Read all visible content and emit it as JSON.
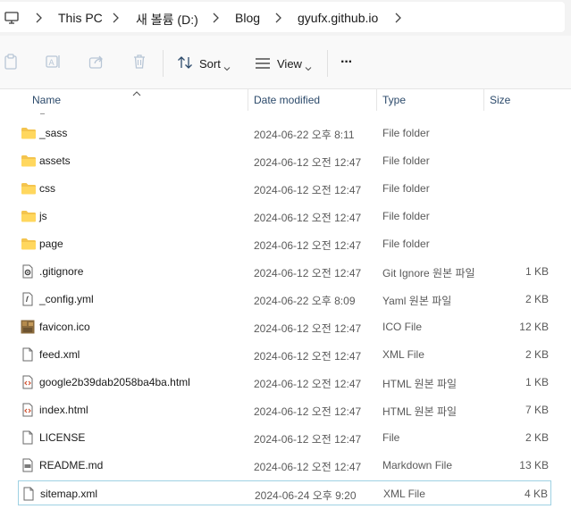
{
  "breadcrumb": [
    "This PC",
    "새 볼륨 (D:)",
    "Blog",
    "gyufx.github.io"
  ],
  "toolbar": {
    "sort_label": "Sort",
    "view_label": "View",
    "more_label": "···"
  },
  "columns": {
    "name": "Name",
    "date": "Date modified",
    "type": "Type",
    "size": "Size"
  },
  "files": [
    {
      "name": "_sass",
      "date": "2024-06-22 오후 8:11",
      "type": "File folder",
      "size": "",
      "icon": "folder-icon"
    },
    {
      "name": "assets",
      "date": "2024-06-12 오전 12:47",
      "type": "File folder",
      "size": "",
      "icon": "folder-icon"
    },
    {
      "name": "css",
      "date": "2024-06-12 오전 12:47",
      "type": "File folder",
      "size": "",
      "icon": "folder-icon"
    },
    {
      "name": "js",
      "date": "2024-06-12 오전 12:47",
      "type": "File folder",
      "size": "",
      "icon": "folder-icon"
    },
    {
      "name": "page",
      "date": "2024-06-12 오전 12:47",
      "type": "File folder",
      "size": "",
      "icon": "folder-icon"
    },
    {
      "name": ".gitignore",
      "date": "2024-06-12 오전 12:47",
      "type": "Git Ignore 원본 파일",
      "size": "1 KB",
      "icon": "gear-file-icon"
    },
    {
      "name": "_config.yml",
      "date": "2024-06-22 오후 8:09",
      "type": "Yaml 원본 파일",
      "size": "2 KB",
      "icon": "script-file-icon"
    },
    {
      "name": "favicon.ico",
      "date": "2024-06-12 오전 12:47",
      "type": "ICO File",
      "size": "12 KB",
      "icon": "image-file-icon"
    },
    {
      "name": "feed.xml",
      "date": "2024-06-12 오전 12:47",
      "type": "XML File",
      "size": "2 KB",
      "icon": "document-icon"
    },
    {
      "name": "google2b39dab2058ba4ba.html",
      "date": "2024-06-12 오전 12:47",
      "type": "HTML 원본 파일",
      "size": "1 KB",
      "icon": "html-file-icon"
    },
    {
      "name": "index.html",
      "date": "2024-06-12 오전 12:47",
      "type": "HTML 원본 파일",
      "size": "7 KB",
      "icon": "html-file-icon"
    },
    {
      "name": "LICENSE",
      "date": "2024-06-12 오전 12:47",
      "type": "File",
      "size": "2 KB",
      "icon": "document-icon"
    },
    {
      "name": "README.md",
      "date": "2024-06-12 오전 12:47",
      "type": "Markdown File",
      "size": "13 KB",
      "icon": "markdown-file-icon"
    },
    {
      "name": "sitemap.xml",
      "date": "2024-06-24 오후 9:20",
      "type": "XML File",
      "size": "4 KB",
      "icon": "document-icon",
      "selected": true
    }
  ]
}
